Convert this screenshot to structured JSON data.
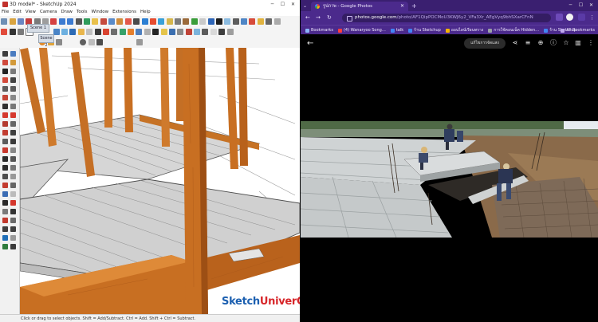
{
  "sketchup": {
    "title": "3D model* - SketchUp 2024",
    "menu": [
      "File",
      "Edit",
      "View",
      "Camera",
      "Draw",
      "Tools",
      "Window",
      "Extensions",
      "Help"
    ],
    "scene_tab_1": "Scene 1",
    "scene_tab_2": "Scene 2",
    "status": "Click or drag to select objects. Shift = Add/Subtract. Ctrl = Add. Shift + Ctrl = Subtract.",
    "watermark_a": "Sketch",
    "watermark_b": "UniverCity",
    "colors": {
      "timber": "#c86f22",
      "slab": "#d3d3d3",
      "watermark_blue": "#1b5fb0",
      "watermark_red": "#d7262a"
    }
  },
  "chrome": {
    "tab_title": "รูปภาพ - Google Photos",
    "url_host": "photos.google.com",
    "url_path": "/photo/AF1QipPOCMoU3KWJ6y2_VFa3Xr_AEgVyq9bhSXarCFnN",
    "bookmarks": [
      {
        "label": "Bookmarks",
        "color": "#8ab4f8"
      },
      {
        "label": "(4) Wanaryoo Song…",
        "color": "#ff3d3d"
      },
      {
        "label": "talk",
        "color": "#4285f4"
      },
      {
        "label": "ร้าน Sketchup",
        "color": "#4285f4"
      },
      {
        "label": "ออนไลน์เรียนทราง",
        "color": "#f4b400"
      },
      {
        "label": "การใช้คอนเน็ค Hidden…",
        "color": "#9aa0a6"
      },
      {
        "label": "ร้าน Sketchup",
        "color": "#4285f4"
      }
    ],
    "all_bookmarks": "All Bookmarks",
    "edit_button": "แก้ไขการจัดแสง",
    "theme": "#4b2a8c"
  }
}
